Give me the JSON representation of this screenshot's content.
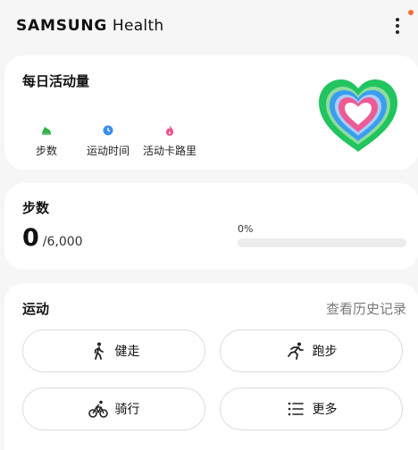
{
  "app": {
    "brand_bold": "SAMSUNG",
    "brand_light": "Health"
  },
  "activity": {
    "title": "每日活动量",
    "metrics": [
      {
        "label": "步数",
        "icon": "shoe-icon",
        "color": "#2fb34a"
      },
      {
        "label": "运动时间",
        "icon": "clock-icon",
        "color": "#3d8ee8"
      },
      {
        "label": "活动卡路里",
        "icon": "flame-icon",
        "color": "#ef4f8a"
      }
    ],
    "rings_icon": "activity-heart-rings-icon",
    "ring_colors": [
      "#21c45f",
      "#3a9ef0",
      "#ee5a96"
    ]
  },
  "steps": {
    "title": "步数",
    "current": "0",
    "goal": "/6,000",
    "percent_text": "0%",
    "progress": 0
  },
  "exercise": {
    "title": "运动",
    "history_link": "查看历史记录",
    "buttons": [
      {
        "label": "健走",
        "icon": "walking-icon"
      },
      {
        "label": "跑步",
        "icon": "running-icon"
      },
      {
        "label": "骑行",
        "icon": "cycling-icon"
      },
      {
        "label": "更多",
        "icon": "list-icon"
      }
    ]
  }
}
